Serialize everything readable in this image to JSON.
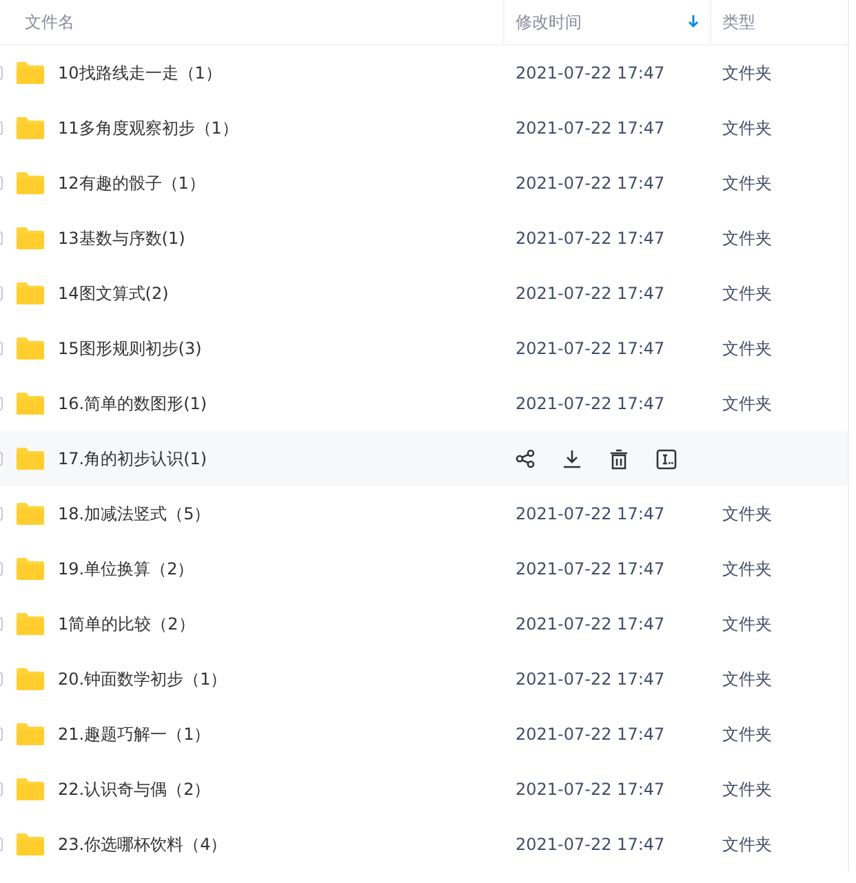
{
  "columns": [
    {
      "label": "文件名",
      "sorted": false
    },
    {
      "label": "修改时间",
      "sorted": true
    },
    {
      "label": "类型",
      "sorted": false
    }
  ],
  "rows": [
    {
      "name": "10找路线走一走（1）",
      "time": "2021-07-22 17:47",
      "type": "文件夹",
      "checked": false,
      "hovered": false
    },
    {
      "name": "11多角度观察初步（1）",
      "time": "2021-07-22 17:47",
      "type": "文件夹",
      "checked": false,
      "hovered": false
    },
    {
      "name": "12有趣的骰子（1）",
      "time": "2021-07-22 17:47",
      "type": "文件夹",
      "checked": false,
      "hovered": false
    },
    {
      "name": "13基数与序数(1)",
      "time": "2021-07-22 17:47",
      "type": "文件夹",
      "checked": false,
      "hovered": false
    },
    {
      "name": "14图文算式(2)",
      "time": "2021-07-22 17:47",
      "type": "文件夹",
      "checked": false,
      "hovered": false
    },
    {
      "name": "15图形规则初步(3)",
      "time": "2021-07-22 17:47",
      "type": "文件夹",
      "checked": false,
      "hovered": false
    },
    {
      "name": "16.简单的数图形(1)",
      "time": "2021-07-22 17:47",
      "type": "文件夹",
      "checked": false,
      "hovered": false
    },
    {
      "name": "17.角的初步认识(1)",
      "checked": false,
      "hovered": true
    },
    {
      "name": "18.加减法竖式（5）",
      "time": "2021-07-22 17:47",
      "type": "文件夹",
      "checked": false,
      "hovered": false
    },
    {
      "name": "19.单位换算（2）",
      "time": "2021-07-22 17:47",
      "type": "文件夹",
      "checked": false,
      "hovered": false
    },
    {
      "name": "1简单的比较（2）",
      "time": "2021-07-22 17:47",
      "type": "文件夹",
      "checked": false,
      "hovered": false
    },
    {
      "name": "20.钟面数学初步（1）",
      "time": "2021-07-22 17:47",
      "type": "文件夹",
      "checked": false,
      "hovered": false
    },
    {
      "name": "21.趣题巧解一（1）",
      "time": "2021-07-22 17:47",
      "type": "文件夹",
      "checked": false,
      "hovered": false
    },
    {
      "name": "22.认识奇与偶（2）",
      "time": "2021-07-22 17:47",
      "type": "文件夹",
      "checked": false,
      "hovered": false
    },
    {
      "name": "23.你选哪杯饮料（4）",
      "time": "2021-07-22 17:47",
      "type": "文件夹",
      "checked": false,
      "hovered": false
    }
  ]
}
